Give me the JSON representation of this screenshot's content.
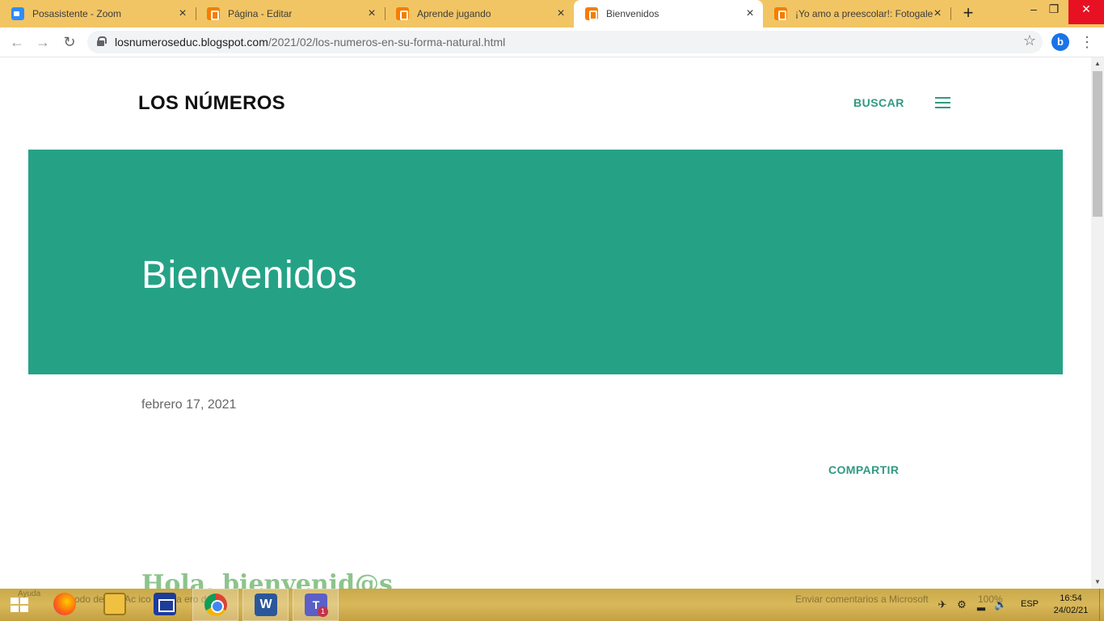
{
  "browser": {
    "tabs": [
      {
        "title": "Posasistente - Zoom",
        "icon": "zoom-icon",
        "active": false
      },
      {
        "title": "Página - Editar",
        "icon": "blogger-icon",
        "active": false
      },
      {
        "title": "Aprende jugando",
        "icon": "blogger-icon",
        "active": false
      },
      {
        "title": "Bienvenidos",
        "icon": "blogger-icon",
        "active": true
      },
      {
        "title": "¡Yo amo a preescolar!: Fotogale",
        "icon": "blogger-icon",
        "active": false
      }
    ],
    "new_tab": "+",
    "url_domain": "losnumeroseduc.blogspot.com",
    "url_path": "/2021/02/los-numeros-en-su-forma-natural.html",
    "profile_initial": "b"
  },
  "page": {
    "site_title": "LOS NÚMEROS",
    "search_label": "BUSCAR",
    "hero_title": "Bienvenidos",
    "post_date": "febrero 17, 2021",
    "share_label": "COMPARTIR",
    "greeting": "Hola, bienvenid@s",
    "accent_color": "#25a286"
  },
  "taskbar": {
    "ghost_text_1": "Ayuda",
    "ghost_text_2": "odo de   ulo: Ac   ico   dística   ero d   ajo",
    "ghost_feedback": "Enviar comentarios a Microsoft",
    "ghost_zoom": "100%",
    "teams_badge": "1",
    "language": "ESP",
    "time": "16:54",
    "date": "24/02/21"
  }
}
